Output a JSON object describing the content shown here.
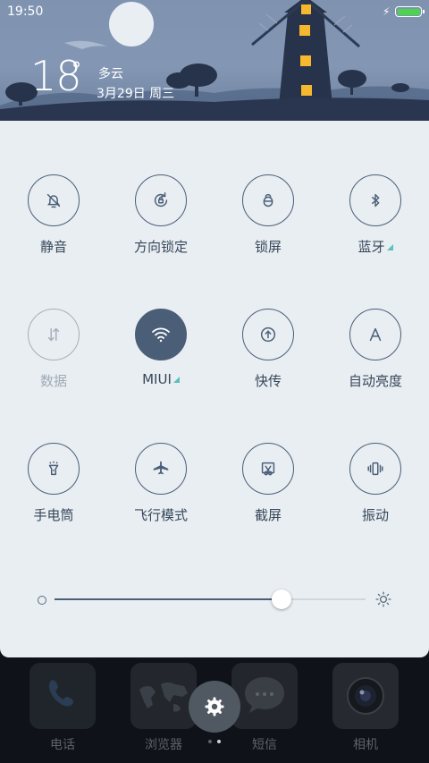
{
  "status_bar": {
    "time": "19:50"
  },
  "weather": {
    "temperature": "18",
    "unit": "°",
    "condition": "多云",
    "date": "3月29日 周三"
  },
  "toggles": [
    {
      "label": "静音",
      "icon": "bell-off-icon",
      "state": "off"
    },
    {
      "label": "方向锁定",
      "icon": "rotation-lock-icon",
      "state": "off"
    },
    {
      "label": "锁屏",
      "icon": "lock-icon",
      "state": "off"
    },
    {
      "label": "蓝牙",
      "icon": "bluetooth-icon",
      "state": "off"
    },
    {
      "label": "数据",
      "icon": "data-arrows-icon",
      "state": "disabled"
    },
    {
      "label": "MIUI",
      "icon": "wifi-icon",
      "state": "on"
    },
    {
      "label": "快传",
      "icon": "share-upload-icon",
      "state": "off"
    },
    {
      "label": "自动亮度",
      "icon": "auto-brightness-icon",
      "state": "off"
    },
    {
      "label": "手电筒",
      "icon": "flashlight-icon",
      "state": "off"
    },
    {
      "label": "飞行模式",
      "icon": "airplane-icon",
      "state": "off"
    },
    {
      "label": "截屏",
      "icon": "screenshot-icon",
      "state": "off"
    },
    {
      "label": "振动",
      "icon": "vibrate-icon",
      "state": "off"
    }
  ],
  "brightness": {
    "level": 0.73
  },
  "dock": [
    {
      "label": "电话"
    },
    {
      "label": "浏览器"
    },
    {
      "label": "短信"
    },
    {
      "label": "相机"
    }
  ],
  "colors": {
    "accent": "#4b5e78",
    "panel": "#e8eef2",
    "battery": "#4cd44c",
    "corner_marker": "#5bc0be"
  }
}
